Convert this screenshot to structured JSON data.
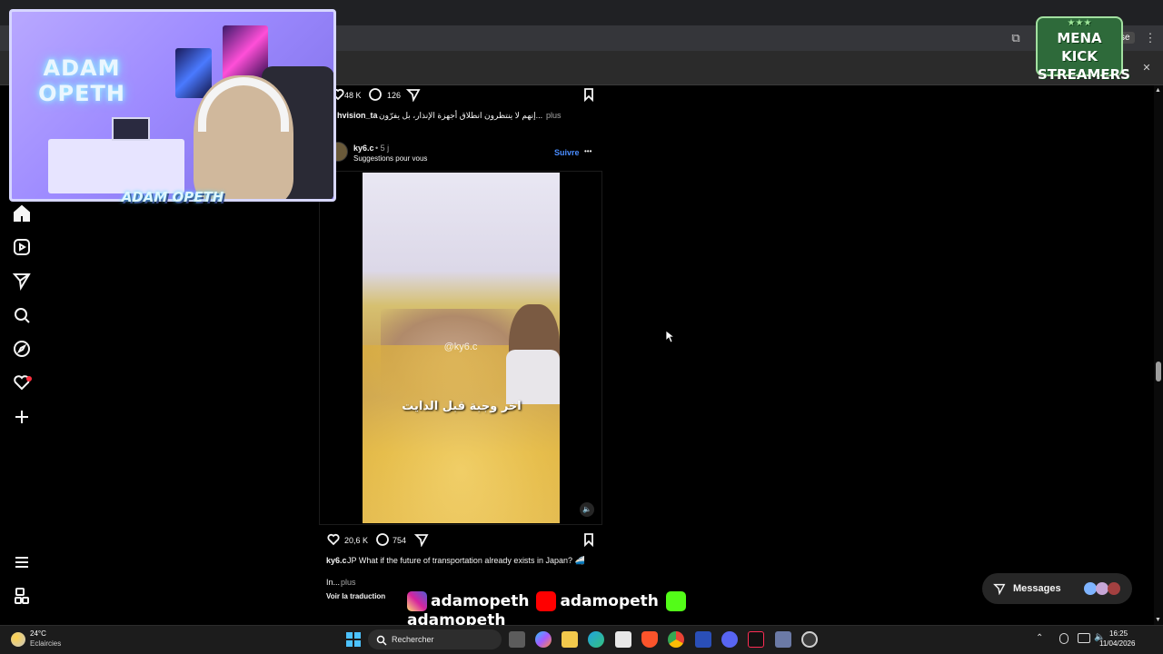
{
  "browser": {
    "record_label": "se",
    "close_glyph": "✕",
    "menu_glyph": "⋮"
  },
  "webcam": {
    "neon_sign": "ADAM OPETH",
    "name_tag": "ADAM OPETH"
  },
  "overlay_logo": {
    "line1": "MENA KICK",
    "line2": "STREAMERS",
    "stars": "★★★"
  },
  "nav": {
    "items": [
      "home-icon",
      "reels-icon",
      "send-icon",
      "search-icon",
      "explore-icon",
      "heart-icon",
      "create-icon"
    ],
    "bottom": [
      "more-menu-icon",
      "meta-icon"
    ]
  },
  "prev_post": {
    "likes": "48 K",
    "comments": "126",
    "username": "hvision_ta",
    "caption": "...إنهم لا ينتظرون انطلاق أجهزة الإنذار، بل يفرّون",
    "more": "plus"
  },
  "post": {
    "username": "ky6.c",
    "time": "• 5 j",
    "subtitle": "Suggestions pour vous",
    "follow": "Suivre",
    "more": "•••",
    "watermark": "@ky6.c",
    "video_caption": "اخر وجبة قبل الدايت",
    "likes": "20,6 K",
    "comments": "754",
    "caption_user": "ky6.c",
    "caption_text": "JP What if the future of transportation already exists in Japan? 🚄",
    "caption_line2": "In...",
    "caption_more": "plus",
    "translate": "Voir la traduction"
  },
  "socials": {
    "items": [
      {
        "platform": "instagram-icon",
        "handle": "adamopeth",
        "color": "#d6249f"
      },
      {
        "platform": "youtube-icon",
        "handle": "adamopeth",
        "color": "#ff0000"
      },
      {
        "platform": "kick-icon",
        "handle": "adamopeth",
        "color": "#53fc18"
      }
    ]
  },
  "messages": {
    "label": "Messages"
  },
  "taskbar": {
    "weather_temp": "24°C",
    "weather_desc": "Eclaircies",
    "search_placeholder": "Rechercher",
    "time": "16:25",
    "date": "11/04/2026"
  }
}
